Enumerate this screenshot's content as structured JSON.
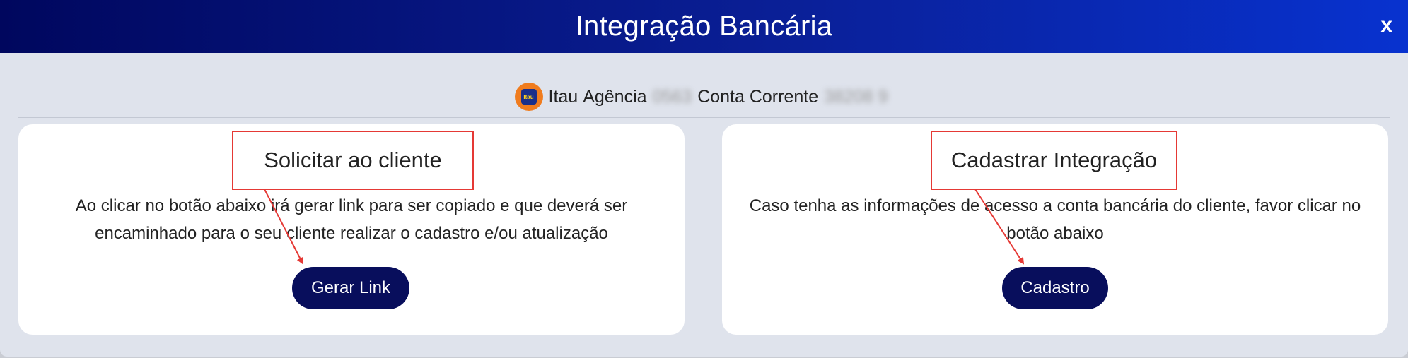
{
  "header": {
    "title": "Integração Bancária",
    "close_label": "x"
  },
  "account": {
    "bank_logo_text": "Itaú",
    "bank_name": "Itau",
    "agency_label": "Agência",
    "agency_value": "0563",
    "account_label": "Conta Corrente",
    "account_value": "38208 9"
  },
  "request_card": {
    "title": "Solicitar ao cliente",
    "description": "Ao clicar no botão abaixo irá gerar link para ser copiado e que deverá ser encaminhado para o seu cliente realizar o cadastro e/ou atualização",
    "button_label": "Gerar Link"
  },
  "register_card": {
    "title": "Cadastrar Integração",
    "description": "Caso tenha as informações de acesso a conta bancária do cliente, favor clicar no botão abaixo",
    "button_label": "Cadastro"
  },
  "colors": {
    "header_start": "#00075e",
    "header_end": "#0832cf",
    "button_bg": "#080e5c",
    "annotation_red": "#e53935",
    "page_bg": "#dfe3ec"
  }
}
